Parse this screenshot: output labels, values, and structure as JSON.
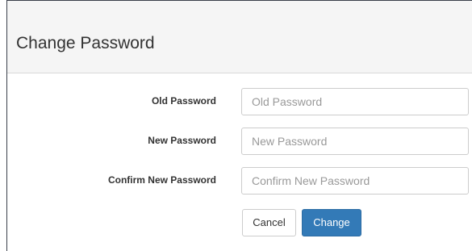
{
  "modal": {
    "title": "Change Password"
  },
  "form": {
    "old_password": {
      "label": "Old Password",
      "placeholder": "Old Password",
      "value": ""
    },
    "new_password": {
      "label": "New Password",
      "placeholder": "New Password",
      "value": ""
    },
    "confirm_password": {
      "label": "Confirm New Password",
      "placeholder": "Confirm New Password",
      "value": ""
    }
  },
  "buttons": {
    "cancel_label": "Cancel",
    "change_label": "Change"
  },
  "colors": {
    "primary": "#337ab7",
    "header_bg": "#f5f5f5",
    "border": "#cccccc"
  }
}
